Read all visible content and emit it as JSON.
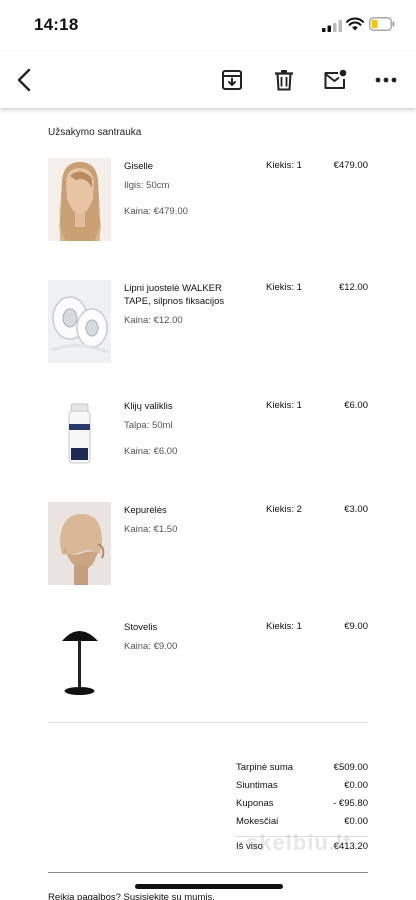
{
  "status_bar": {
    "time": "14:18"
  },
  "toolbar": {
    "back_icon": "chevron-left-icon",
    "archive_icon": "archive-icon",
    "delete_icon": "trash-icon",
    "mark_unread_icon": "mail-unread-icon",
    "more_icon": "more-horizontal-icon"
  },
  "order": {
    "summary_title": "Užsakymo santrauka",
    "items": [
      {
        "name": "Giselle",
        "detail": "Ilgis: 50cm",
        "unit_price": "Kaina: €479.00",
        "quantity": "Kiekis: 1",
        "total": "€479.00"
      },
      {
        "name": "Lipni juostelė WALKER TAPE, silpnos fiksacijos",
        "detail": "",
        "unit_price": "Kaina: €12.00",
        "quantity": "Kiekis: 1",
        "total": "€12.00"
      },
      {
        "name": "Klijų valiklis",
        "detail": "Talpa: 50ml",
        "unit_price": "Kaina: €6.00",
        "quantity": "Kiekis: 1",
        "total": "€6.00"
      },
      {
        "name": "Kepurėlės",
        "detail": "",
        "unit_price": "Kaina: €1.50",
        "quantity": "Kiekis: 2",
        "total": "€3.00"
      },
      {
        "name": "Stovelis",
        "detail": "",
        "unit_price": "Kaina: €9.00",
        "quantity": "Kiekis: 1",
        "total": "€9.00"
      }
    ],
    "totals": {
      "subtotal_label": "Tarpinė suma",
      "subtotal": "€509.00",
      "shipping_label": "Siuntimas",
      "shipping": "€0.00",
      "coupon_label": "Kuponas",
      "coupon": "- €95.80",
      "tax_label": "Mokesčiai",
      "tax": "€0.00",
      "total_label": "Iš viso",
      "total": "€413.20"
    },
    "help_text": "Reikia pagalbos? Susisiekite su mumis.",
    "watermark": "skelbiu.lt"
  }
}
